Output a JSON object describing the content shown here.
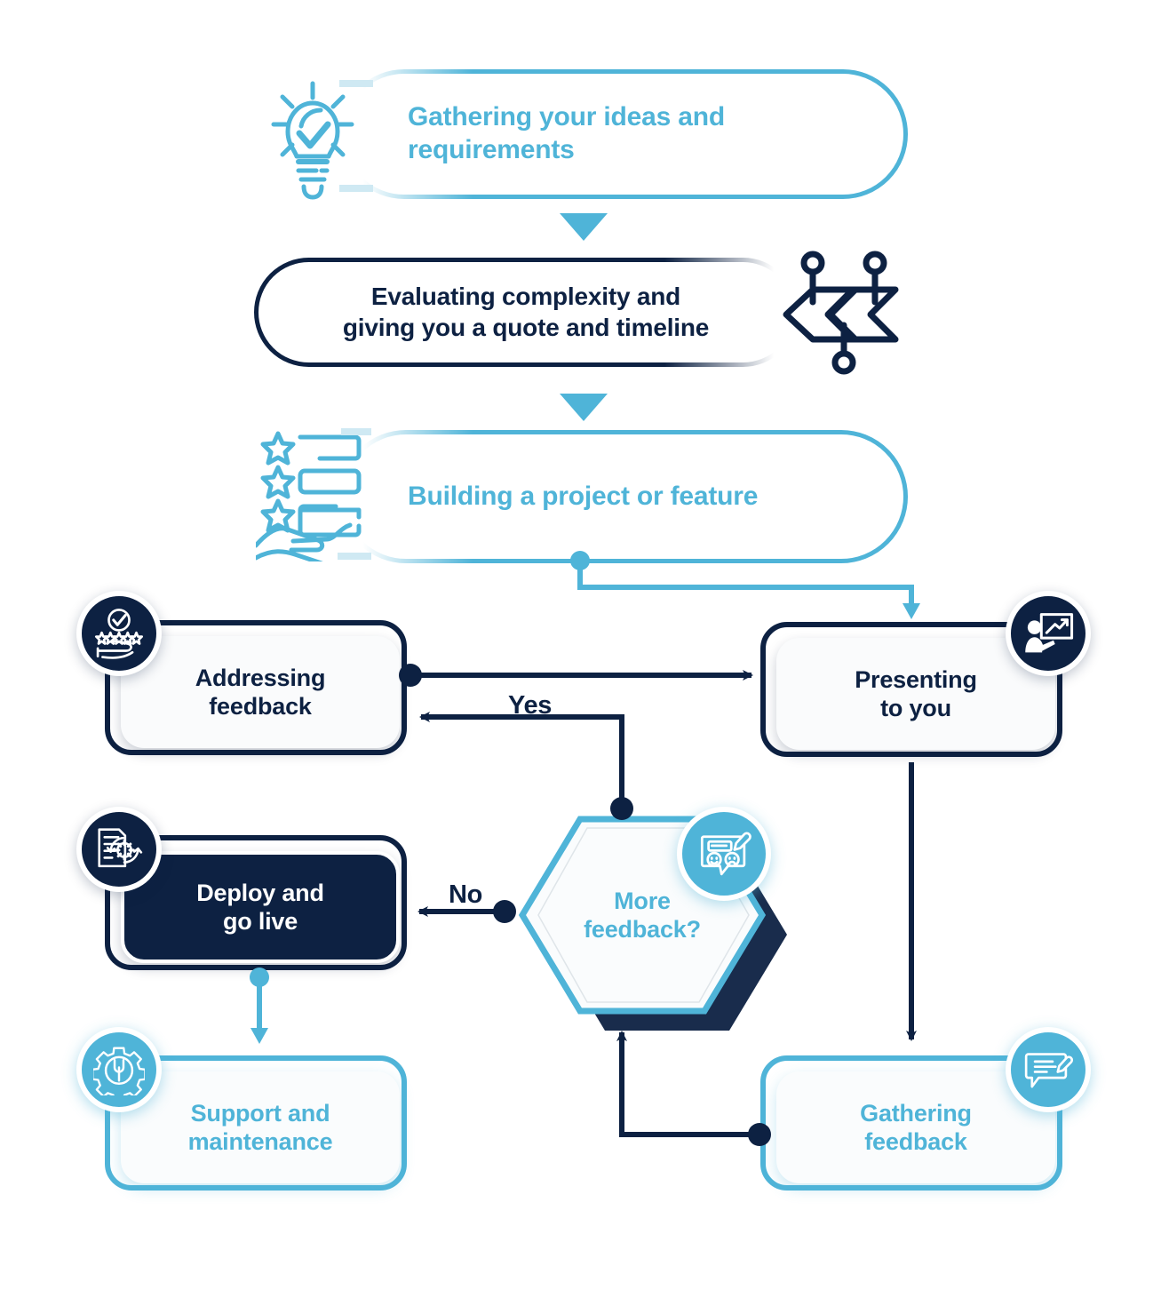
{
  "diagram": {
    "title": "Project delivery process flowchart",
    "colors": {
      "navy": "#0d2142",
      "light_blue": "#4fb4d8",
      "white": "#ffffff",
      "card_fill": "#fafbfc"
    },
    "nodes": [
      {
        "id": "gathering-ideas",
        "label": "Gathering your ideas and\nrequirements",
        "shape": "pill",
        "style": "light-blue-outline",
        "icon": "lightbulb-check-icon",
        "icon_color": "#4fb4d8"
      },
      {
        "id": "evaluating-complexity",
        "label": "Evaluating complexity and\ngiving you a quote and timeline",
        "shape": "pill",
        "style": "navy-outline",
        "icon": "complexity-arrows-icon",
        "icon_color": "#0d2142"
      },
      {
        "id": "building-project",
        "label": "Building a project or feature",
        "shape": "pill",
        "style": "light-blue-outline",
        "icon": "stars-checklist-hand-icon",
        "icon_color": "#4fb4d8"
      },
      {
        "id": "addressing-feedback",
        "label": "Addressing\nfeedback",
        "shape": "rounded-card",
        "style": "navy-outline",
        "icon": "stars-hand-approval-icon",
        "icon_color": "#0d2142"
      },
      {
        "id": "presenting-to-you",
        "label": "Presenting\nto you",
        "shape": "rounded-card",
        "style": "navy-outline",
        "icon": "presentation-chart-person-icon",
        "icon_color": "#0d2142"
      },
      {
        "id": "deploy-go-live",
        "label": "Deploy and\ngo live",
        "shape": "rounded-card",
        "style": "navy-filled",
        "icon": "deploy-gear-cycle-icon",
        "icon_color": "#0d2142"
      },
      {
        "id": "more-feedback",
        "label": "More\nfeedback?",
        "shape": "hexagon",
        "style": "light-blue-outline",
        "icon": "feedback-survey-icon",
        "icon_color": "#4fb4d8"
      },
      {
        "id": "support-maintenance",
        "label": "Support and\nmaintenance",
        "shape": "rounded-card",
        "style": "light-blue-outline",
        "icon": "gear-wrench-icon",
        "icon_color": "#4fb4d8"
      },
      {
        "id": "gathering-feedback",
        "label": "Gathering\nfeedback",
        "shape": "rounded-card",
        "style": "light-blue-outline",
        "icon": "comment-edit-icon",
        "icon_color": "#4fb4d8"
      }
    ],
    "edge_labels": {
      "yes": "Yes",
      "no": "No"
    },
    "edges": [
      {
        "from": "gathering-ideas",
        "to": "evaluating-complexity",
        "label": "",
        "color": "#4fb4d8"
      },
      {
        "from": "evaluating-complexity",
        "to": "building-project",
        "label": "",
        "color": "#4fb4d8"
      },
      {
        "from": "building-project",
        "to": "presenting-to-you",
        "label": "",
        "color": "#4fb4d8"
      },
      {
        "from": "addressing-feedback",
        "to": "presenting-to-you",
        "label": "",
        "color": "#0d2142"
      },
      {
        "from": "presenting-to-you",
        "to": "gathering-feedback",
        "label": "",
        "color": "#0d2142"
      },
      {
        "from": "gathering-feedback",
        "to": "more-feedback",
        "label": "",
        "color": "#0d2142"
      },
      {
        "from": "more-feedback",
        "to": "addressing-feedback",
        "label": "Yes",
        "color": "#0d2142"
      },
      {
        "from": "more-feedback",
        "to": "deploy-go-live",
        "label": "No",
        "color": "#0d2142"
      },
      {
        "from": "deploy-go-live",
        "to": "support-maintenance",
        "label": "",
        "color": "#4fb4d8"
      }
    ]
  }
}
